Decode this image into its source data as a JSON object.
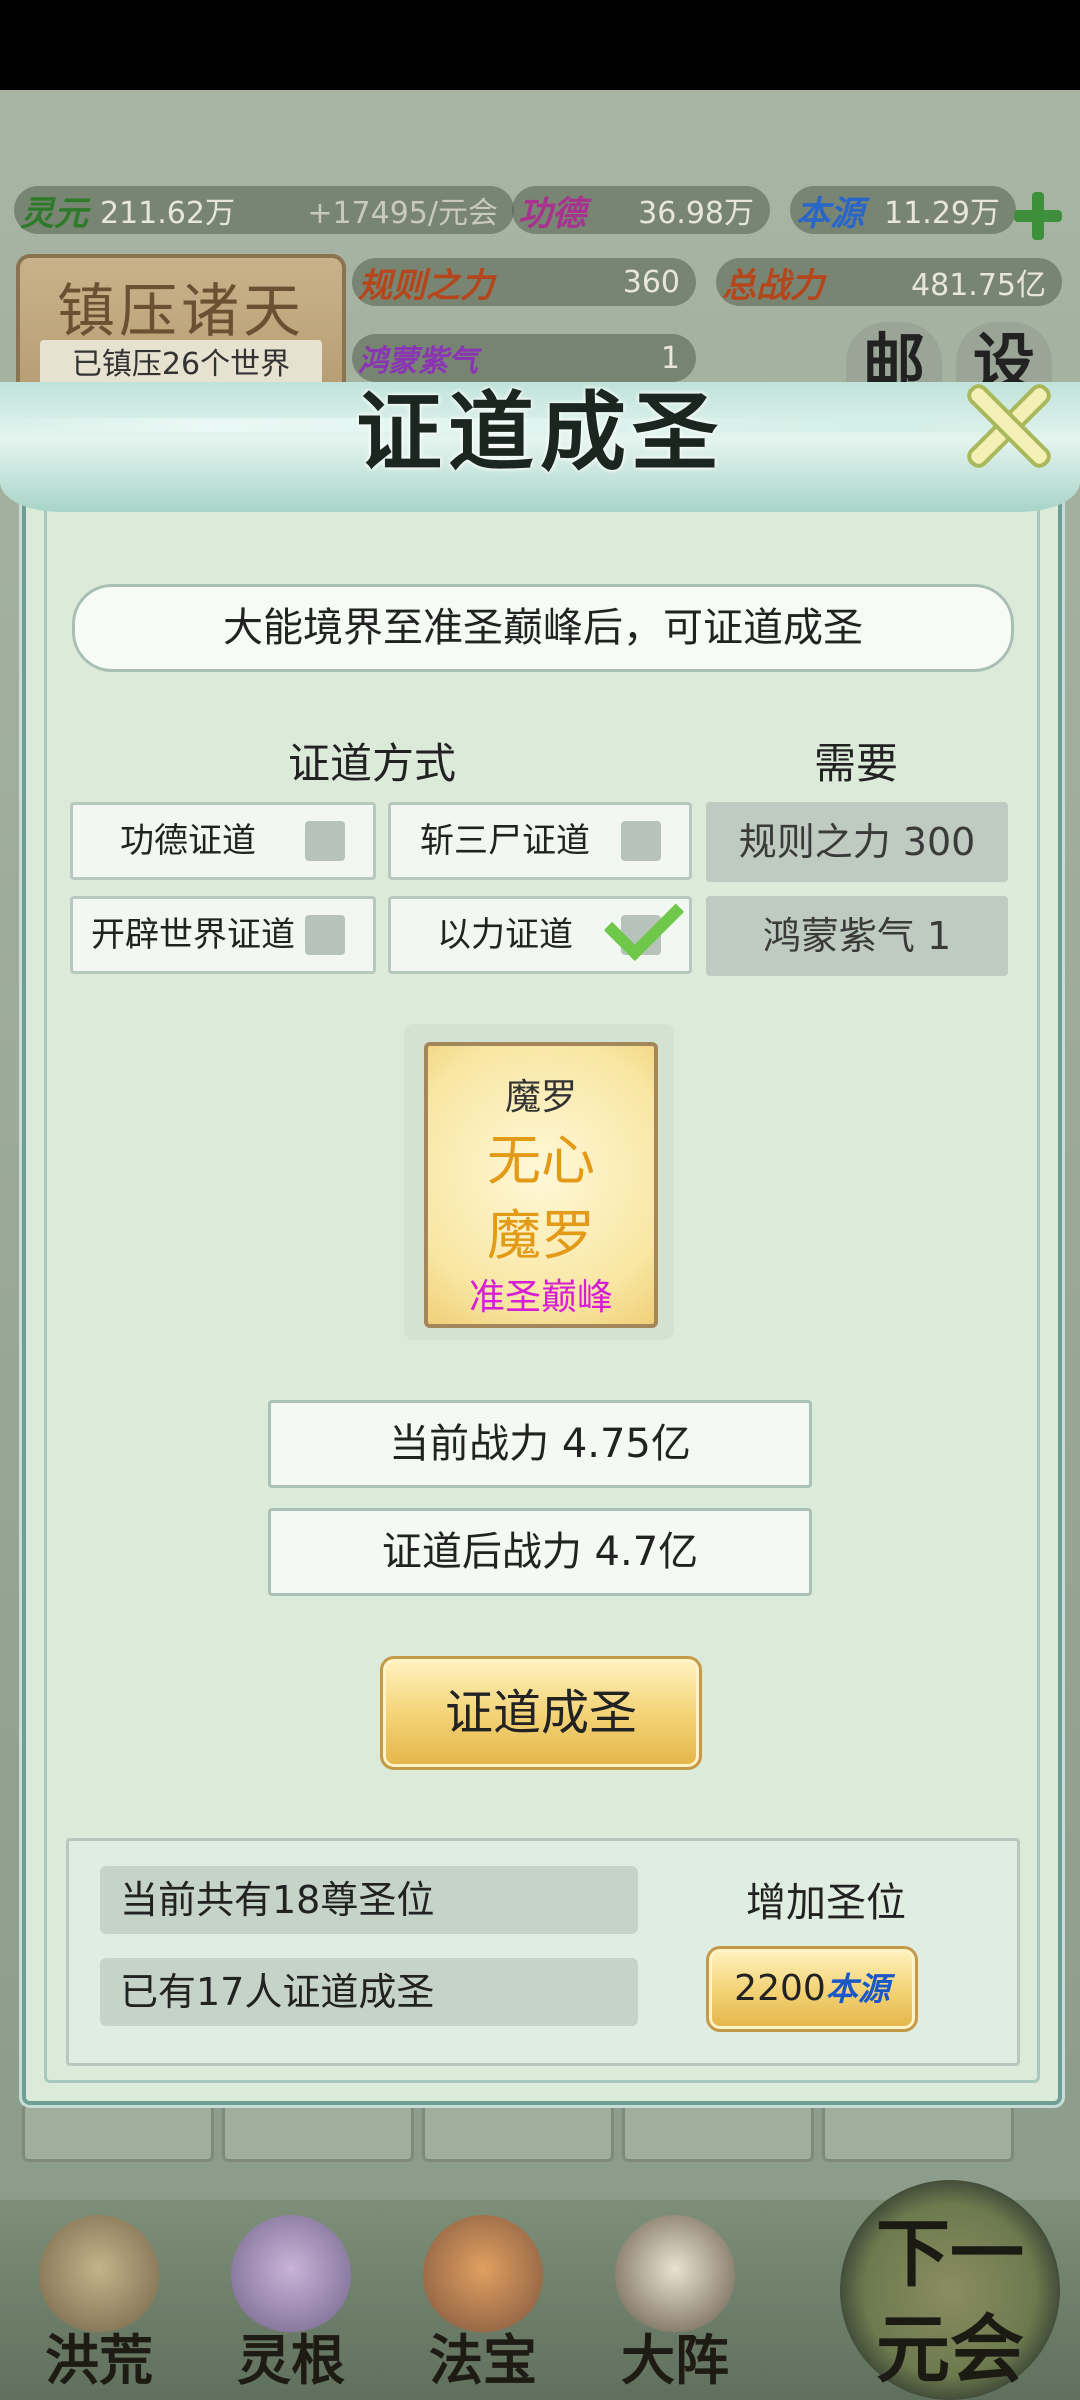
{
  "resources": {
    "lingyuan": {
      "label": "灵元",
      "value": "211.62万",
      "rate": "+17495/元会"
    },
    "gongde": {
      "label": "功德",
      "value": "36.98万"
    },
    "benyuan": {
      "label": "本源",
      "value": "11.29万"
    },
    "guize": {
      "label": "规则之力",
      "value": "360"
    },
    "zongzhanli": {
      "label": "总战力",
      "value": "481.75亿"
    },
    "hongmeng": {
      "label": "鸿蒙紫气",
      "value": "1"
    }
  },
  "zhenya": {
    "title": "镇压诸天",
    "subtitle": "已镇压26个世界"
  },
  "topbuttons": {
    "mail": "邮",
    "settings": "设"
  },
  "modal": {
    "title": "证道成圣",
    "notice": "大能境界至准圣巅峰后，可证道成圣",
    "method_header": "证道方式",
    "need_header": "需要",
    "options": [
      {
        "label": "功德证道",
        "checked": false
      },
      {
        "label": "斩三尸证道",
        "checked": false
      },
      {
        "label": "开辟世界证道",
        "checked": false
      },
      {
        "label": "以力证道",
        "checked": true
      }
    ],
    "requirements": [
      "规则之力 300",
      "鸿蒙紫气 1"
    ],
    "card": {
      "line1": "魔罗",
      "line2": "无心",
      "line3": "魔罗",
      "realm": "准圣巅峰"
    },
    "current_power": "当前战力  4.75亿",
    "after_power": "证道后战力  4.7亿",
    "action_button": "证道成圣",
    "saint_total": "当前共有18尊圣位",
    "saint_done": "已有17人证道成圣",
    "add_saint_label": "增加圣位",
    "add_saint_cost": "2200",
    "add_saint_currency": "本源"
  },
  "nav": [
    "洪荒",
    "灵根",
    "法宝",
    "大阵"
  ],
  "next_era": {
    "line1": "下一",
    "line2": "元会"
  }
}
